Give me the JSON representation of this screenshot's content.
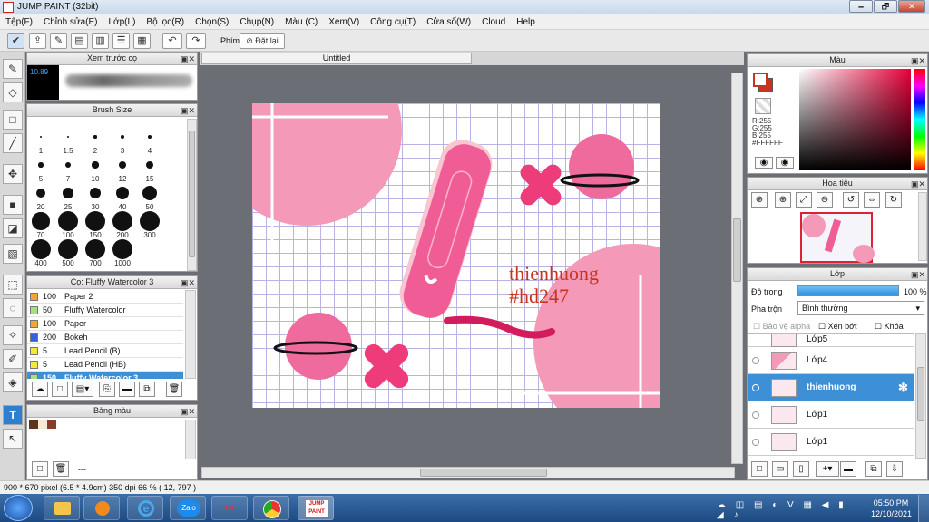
{
  "window": {
    "title": "JUMP PAINT (32bit)",
    "min": "🗕",
    "max": "🗗",
    "close": "✕"
  },
  "menu": [
    "Tệp(F)",
    "Chỉnh sửa(E)",
    "Lớp(L)",
    "Bộ lọc(R)",
    "Chọn(S)",
    "Chụp(N)",
    "Màu (C)",
    "Xem(V)",
    "Công cụ(T)",
    "Cửa sổ(W)",
    "Cloud",
    "Help"
  ],
  "toolbar": {
    "undo": "↶",
    "redo": "↷",
    "shortcut_label": "Phím",
    "reset_label": "Đặt lại"
  },
  "preview": {
    "title": "Xem trước cọ",
    "size": "10.89"
  },
  "brush_size": {
    "title": "Brush Size",
    "values": [
      "1",
      "1.5",
      "2",
      "3",
      "4",
      "5",
      "7",
      "10",
      "12",
      "15",
      "20",
      "25",
      "30",
      "40",
      "50",
      "70",
      "100",
      "150",
      "200",
      "300",
      "400",
      "500",
      "700",
      "1000"
    ]
  },
  "brush_list": {
    "title": "Cọ: Fluffy Watercolor 3",
    "items": [
      {
        "size": "100",
        "name": "Paper 2",
        "color": "#f0a43a"
      },
      {
        "size": "50",
        "name": "Fluffy Watercolor",
        "color": "#a6e07e"
      },
      {
        "size": "100",
        "name": "Paper",
        "color": "#f0a43a"
      },
      {
        "size": "200",
        "name": "Bokeh",
        "color": "#3a5ee0"
      },
      {
        "size": "5",
        "name": "Lead Pencil (B)",
        "color": "#f3e93b"
      },
      {
        "size": "5",
        "name": "Lead Pencil (HB)",
        "color": "#f3e93b"
      },
      {
        "size": "150",
        "name": "Fluffy Watercolor 3",
        "color": "#a6e07e"
      }
    ]
  },
  "palette": {
    "title": "Bảng màu",
    "swatches": [
      "#5a3520",
      "#f5e9d8",
      "#8a3a2a"
    ],
    "footer": "---"
  },
  "document": {
    "tab": "Untitled",
    "watermark_line1": "thienhuong",
    "watermark_line2": "#hd247"
  },
  "color": {
    "title": "Màu",
    "r": "R:255",
    "g": "G:255",
    "b": "B:255",
    "hex": "#FFFFFF",
    "fg": "#c8321e",
    "bg": "#ffffff"
  },
  "navigator": {
    "title": "Hoa tiêu"
  },
  "layers": {
    "title": "Lớp",
    "opacity_label": "Độ trong",
    "opacity_value": "100 %",
    "blend_label": "Pha trộn",
    "blend_value": "Bình thường",
    "protect_alpha": "Bảo vệ alpha",
    "clipping": "Xén bớt",
    "lock": "Khóa",
    "items": [
      {
        "name": "Lớp5",
        "selected": false
      },
      {
        "name": "Lớp4",
        "selected": false
      },
      {
        "name": "thienhuong",
        "selected": true
      },
      {
        "name": "Lớp1",
        "selected": false
      },
      {
        "name": "Lớp1",
        "selected": false
      }
    ]
  },
  "status": {
    "text": "900 * 670 pixel   (6.5 * 4.9cm)   350 dpi   66 %   ( 12, 797 )"
  },
  "taskbar": {
    "time": "05:50 PM",
    "date": "12/10/2021",
    "zalo": "Zalo",
    "jump": "JUMP PAINT"
  }
}
